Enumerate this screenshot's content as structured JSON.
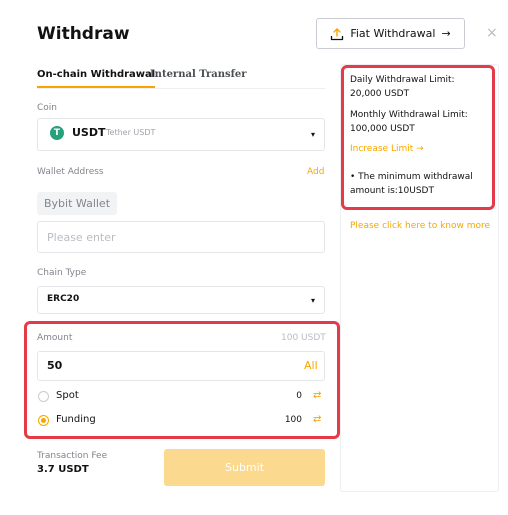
{
  "header": {
    "title": "Withdraw",
    "fiat_button_label": "Fiat Withdrawal",
    "fiat_button_arrow": "→",
    "close_glyph": "×"
  },
  "tabs": [
    {
      "label": "On-chain Withdrawal",
      "active": true
    },
    {
      "label": "Internal Transfer",
      "active": false
    }
  ],
  "coin": {
    "label": "Coin",
    "icon_letter": "T",
    "code": "USDT",
    "name": "Tether USDT",
    "caret": "▾"
  },
  "wallet": {
    "label": "Wallet Address",
    "add_label": "Add",
    "chip": "Bybit Wallet",
    "placeholder": "Please enter"
  },
  "chain": {
    "label": "Chain Type",
    "value": "ERC20",
    "caret": "▾"
  },
  "amount": {
    "label": "Amount",
    "available": "100 USDT",
    "value": "50",
    "all_label": "All"
  },
  "sources": [
    {
      "label": "Spot",
      "value": "0",
      "selected": false
    },
    {
      "label": "Funding",
      "value": "100",
      "selected": true
    }
  ],
  "fee": {
    "label": "Transaction Fee",
    "value": "3.7 USDT"
  },
  "submit_label": "Submit",
  "limits": {
    "daily_label": "Daily Withdrawal Limit:",
    "daily_value": "20,000 USDT",
    "monthly_label": "Monthly Withdrawal Limit:",
    "monthly_value": "100,000 USDT",
    "increase_label": "Increase Limit →",
    "min_line1": "• The minimum withdrawal",
    "min_line2": "amount is:10USDT"
  },
  "know_more": "Please click here to know more",
  "colors": {
    "accent": "#f7a600",
    "highlight": "#e53b48",
    "usdt": "#26a17b"
  }
}
